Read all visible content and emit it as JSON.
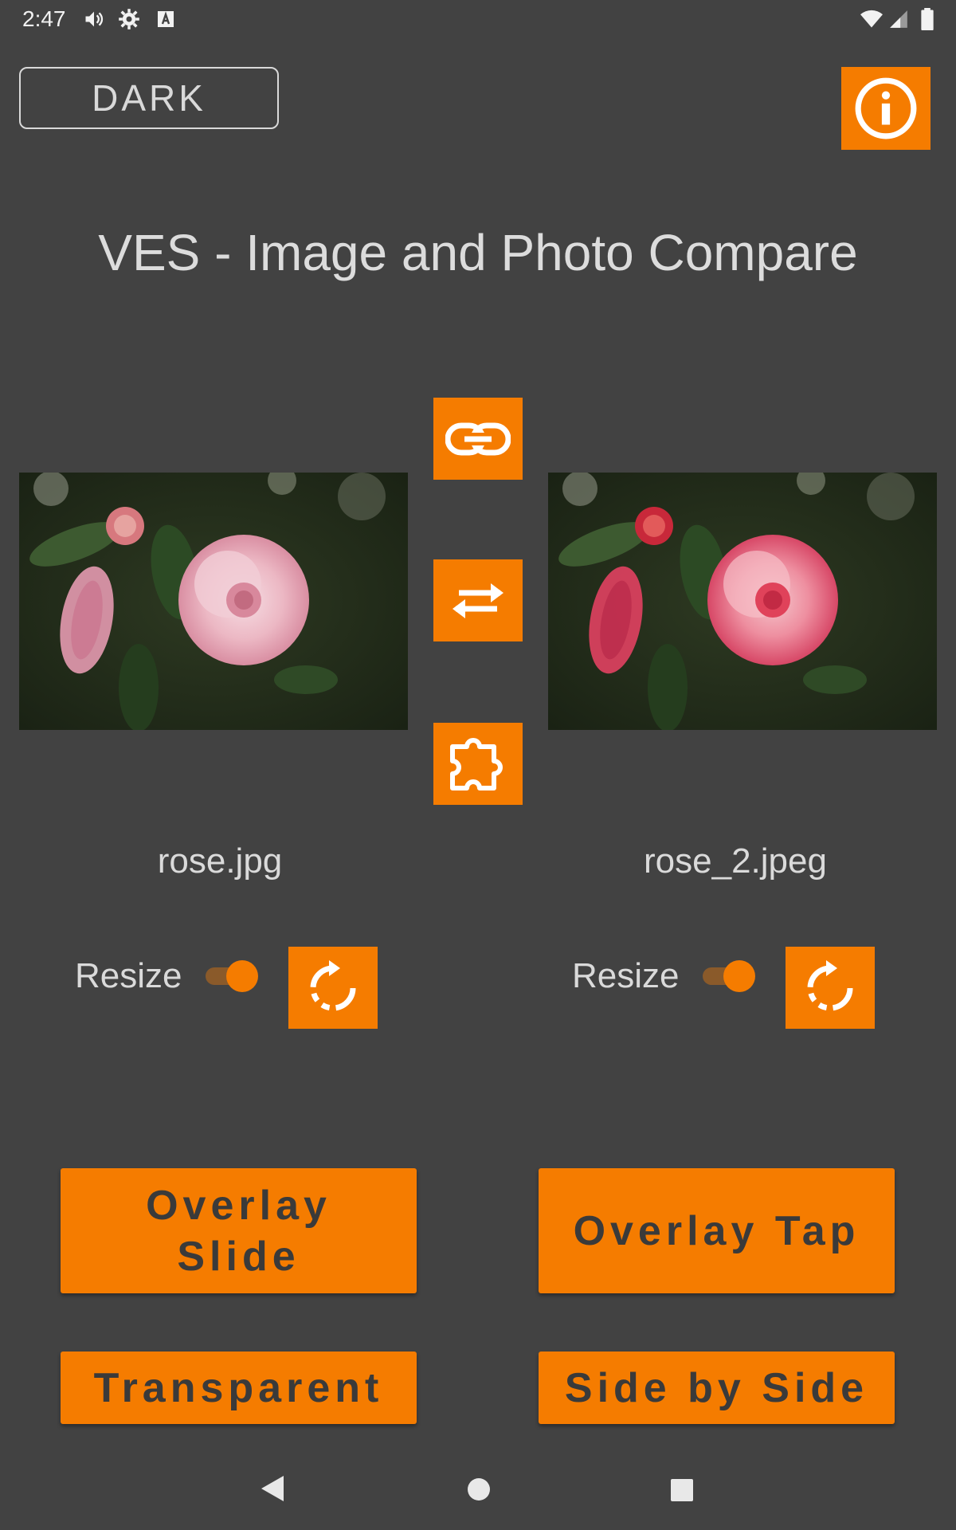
{
  "status_bar": {
    "time": "2:47"
  },
  "header": {
    "theme_button": "DARK"
  },
  "title": "VES - Image and Photo Compare",
  "images": [
    {
      "filename": "rose.jpg",
      "resize_label": "Resize",
      "resize_on": true
    },
    {
      "filename": "rose_2.jpeg",
      "resize_label": "Resize",
      "resize_on": true
    }
  ],
  "buttons": {
    "overlay_slide": "Overlay\nSlide",
    "overlay_tap": "Overlay Tap",
    "transparent": "Transparent",
    "side_by_side": "Side by Side"
  },
  "colors": {
    "accent": "#f57c00",
    "background": "#424242"
  },
  "icons": [
    "info-icon",
    "link-icon",
    "swap-icon",
    "puzzle-icon",
    "rotate-icon"
  ]
}
